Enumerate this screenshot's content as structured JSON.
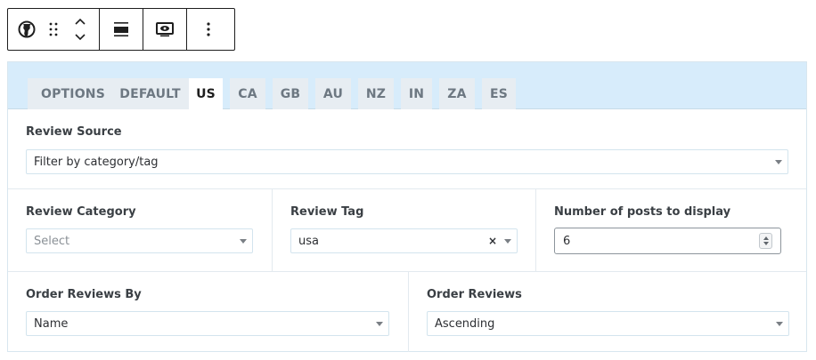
{
  "toolbar": {
    "icons": [
      "globe-icon",
      "drag-handle-icon",
      "move-up-icon",
      "move-down-icon",
      "align-icon",
      "preview-icon",
      "more-options-icon"
    ]
  },
  "tabs": [
    {
      "label": "OPTIONS",
      "active": false
    },
    {
      "label": "DEFAULT",
      "active": false
    },
    {
      "label": "US",
      "active": true
    },
    {
      "label": "CA",
      "active": false
    },
    {
      "label": "GB",
      "active": false
    },
    {
      "label": "AU",
      "active": false
    },
    {
      "label": "NZ",
      "active": false
    },
    {
      "label": "IN",
      "active": false
    },
    {
      "label": "ZA",
      "active": false
    },
    {
      "label": "ES",
      "active": false
    }
  ],
  "review_source": {
    "label": "Review Source",
    "value": "Filter by category/tag"
  },
  "review_category": {
    "label": "Review Category",
    "placeholder": "Select"
  },
  "review_tag": {
    "label": "Review Tag",
    "value": "usa",
    "clear_glyph": "×"
  },
  "posts_count": {
    "label": "Number of posts to display",
    "value": "6"
  },
  "order_by": {
    "label": "Order Reviews By",
    "value": "Name"
  },
  "order": {
    "label": "Order Reviews",
    "value": "Ascending"
  },
  "colors": {
    "tabbar_bg": "#d7ecfb",
    "tab_bg": "#e7edf2",
    "active_tab_bg": "#ffffff",
    "border": "#d3e4ee"
  }
}
